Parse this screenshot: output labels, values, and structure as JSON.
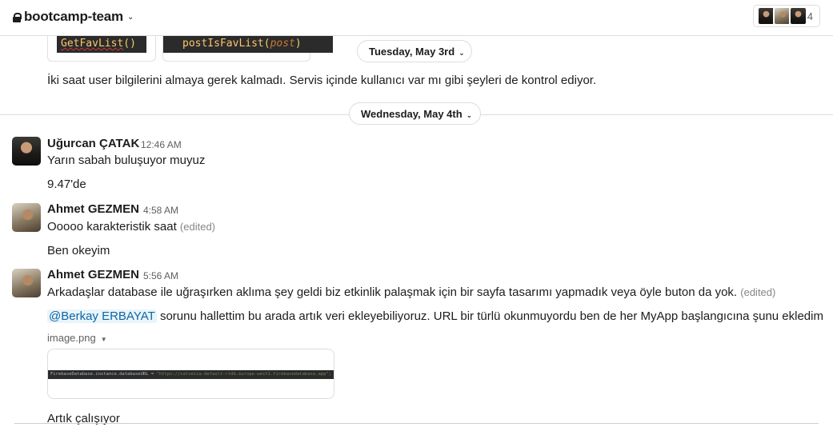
{
  "header": {
    "channel_name": "bootcamp-team",
    "member_count": "4"
  },
  "snippets": {
    "left_code_func": "GetFavList",
    "left_code_parens": "()",
    "right_code_func": "postIsFavList",
    "right_code_param": "post"
  },
  "earlier_message": {
    "text": "İki saat user bilgilerini almaya gerek kalmadı. Servis içinde kullanıcı var mı gibi şeyleri de kontrol ediyor."
  },
  "dividers": {
    "tuesday": "Tuesday, May 3rd",
    "wednesday": "Wednesday, May 4th"
  },
  "messages": [
    {
      "sender": "Uğurcan ÇATAK",
      "time": "12:46 AM",
      "lines": [
        "Yarın sabah buluşuyor muyuz",
        "9.47'de"
      ]
    },
    {
      "sender": "Ahmet GEZMEN",
      "time": "4:58 AM",
      "line1": "Ooooo karakteristik saat",
      "edited": "(edited)",
      "line2": "Ben okeyim"
    },
    {
      "sender": "Ahmet GEZMEN",
      "time": "5:56 AM",
      "line1": "Arkadaşlar database ile uğraşırken aklıma şey geldi biz etkinlik palaşmak için bir sayfa tasarımı yapmadık veya öyle buton da yok.",
      "edited": "(edited)",
      "mention": "@Berkay ERBAYAT",
      "line2": "sorunu hallettim bu arada artık veri ekleyebiliyoruz. URL bir türlü okunmuyordu ben de her MyApp başlangıcına şunu ekledim",
      "file_name": "image.png",
      "image_code": "FirebaseDatabase.instance.databaseURL = ",
      "image_code_string": "\"https://calvesia-default-rtdb.europe-west1.firebasedatabase.app\";",
      "line3": "Artık çalışıyor"
    }
  ],
  "icons": {
    "lock": "lock-icon",
    "chevron": "chevron-down-icon",
    "file_menu": "caret-down-icon"
  }
}
